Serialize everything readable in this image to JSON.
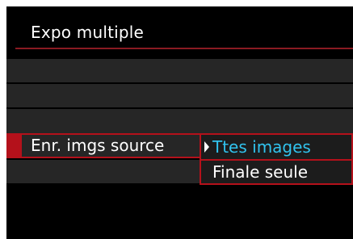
{
  "menu": {
    "title": "Expo multiple",
    "selected_item": {
      "label": "Enr. imgs source"
    },
    "options": [
      {
        "label": "Ttes images",
        "selected": true
      },
      {
        "label": "Finale seule",
        "selected": false
      }
    ]
  },
  "colors": {
    "accent": "#b4111b",
    "selected_option": "#31c3ee",
    "row_background": "#262626"
  }
}
